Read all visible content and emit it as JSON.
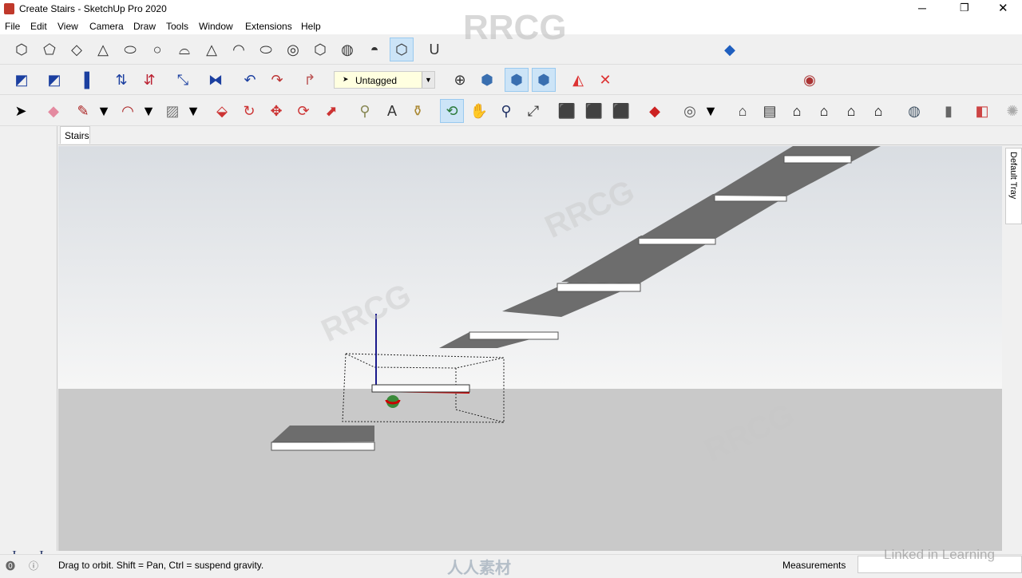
{
  "window": {
    "title": "Create Stairs - SketchUp Pro 2020",
    "controls": [
      "minimize",
      "maximize",
      "close"
    ]
  },
  "menu": [
    "File",
    "Edit",
    "View",
    "Camera",
    "Draw",
    "Tools",
    "Window",
    "Extensions",
    "Help"
  ],
  "toolbar": {
    "tag_dropdown": "Untagged"
  },
  "tabs": [
    {
      "label": "Stairs",
      "active": true
    }
  ],
  "tray": {
    "label": "Default Tray"
  },
  "status": {
    "message": "Drag to orbit. Shift = Pan, Ctrl = suspend gravity.",
    "measurements_label": "Measurements",
    "measurements_value": ""
  },
  "watermarks": {
    "top": "RRCG",
    "brand": "人人素材",
    "linkedin": "Linked in Learning"
  },
  "colors": {
    "sky_top": "#d9dde2",
    "horizon": "#f6f6f6",
    "ground": "#c9c9c9",
    "tread": "#6d6d6d",
    "active_tool": "#cce4f7"
  }
}
